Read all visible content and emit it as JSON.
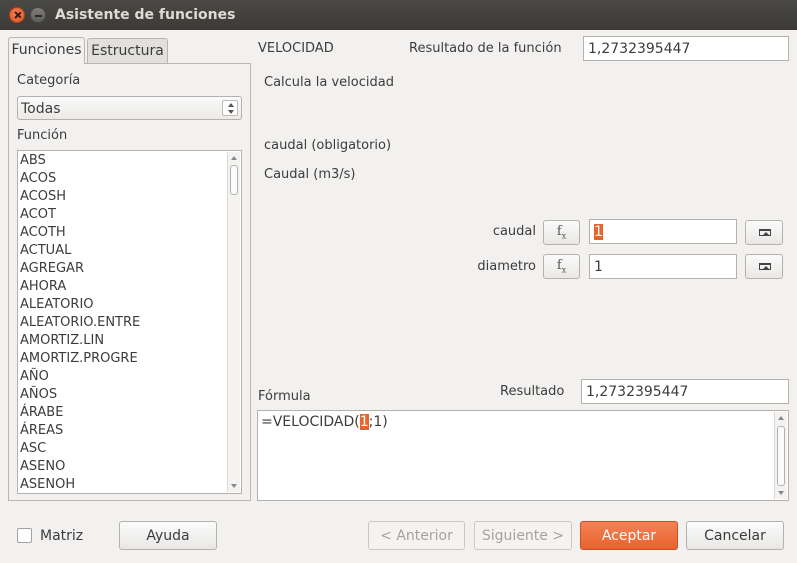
{
  "window": {
    "title": "Asistente de funciones"
  },
  "tabs": [
    {
      "label": "Funciones"
    },
    {
      "label": "Estructura"
    }
  ],
  "left": {
    "category_label": "Categoría",
    "category_value": "Todas",
    "function_label": "Función",
    "functions": [
      "ABS",
      "ACOS",
      "ACOSH",
      "ACOT",
      "ACOTH",
      "ACTUAL",
      "AGREGAR",
      "AHORA",
      "ALEATORIO",
      "ALEATORIO.ENTRE",
      "AMORTIZ.LIN",
      "AMORTIZ.PROGRE",
      "AÑO",
      "AÑOS",
      "ÁRABE",
      "ÁREAS",
      "ASC",
      "ASENO",
      "ASENOH"
    ]
  },
  "right": {
    "function_name": "VELOCIDAD",
    "result_label": "Resultado de la función",
    "result_value": "1,2732395447",
    "description": "Calcula la velocidad",
    "param_title": "caudal (obligatorio)",
    "param_desc": "Caudal (m3/s)",
    "args": [
      {
        "label": "caudal",
        "value": "1"
      },
      {
        "label": "diametro",
        "value": "1"
      }
    ],
    "fx_label": "f",
    "fx_sub": "x"
  },
  "formula": {
    "label": "Fórmula",
    "result_label": "Resultado",
    "result_value": "1,2732395447",
    "text_before": "=VELOCIDAD(",
    "text_selected": "1",
    "text_after": ";1)"
  },
  "bottom": {
    "matrix_label": "Matriz",
    "help": "Ayuda",
    "prev": "< Anterior",
    "next": "Siguiente >",
    "ok": "Aceptar",
    "cancel": "Cancelar"
  }
}
